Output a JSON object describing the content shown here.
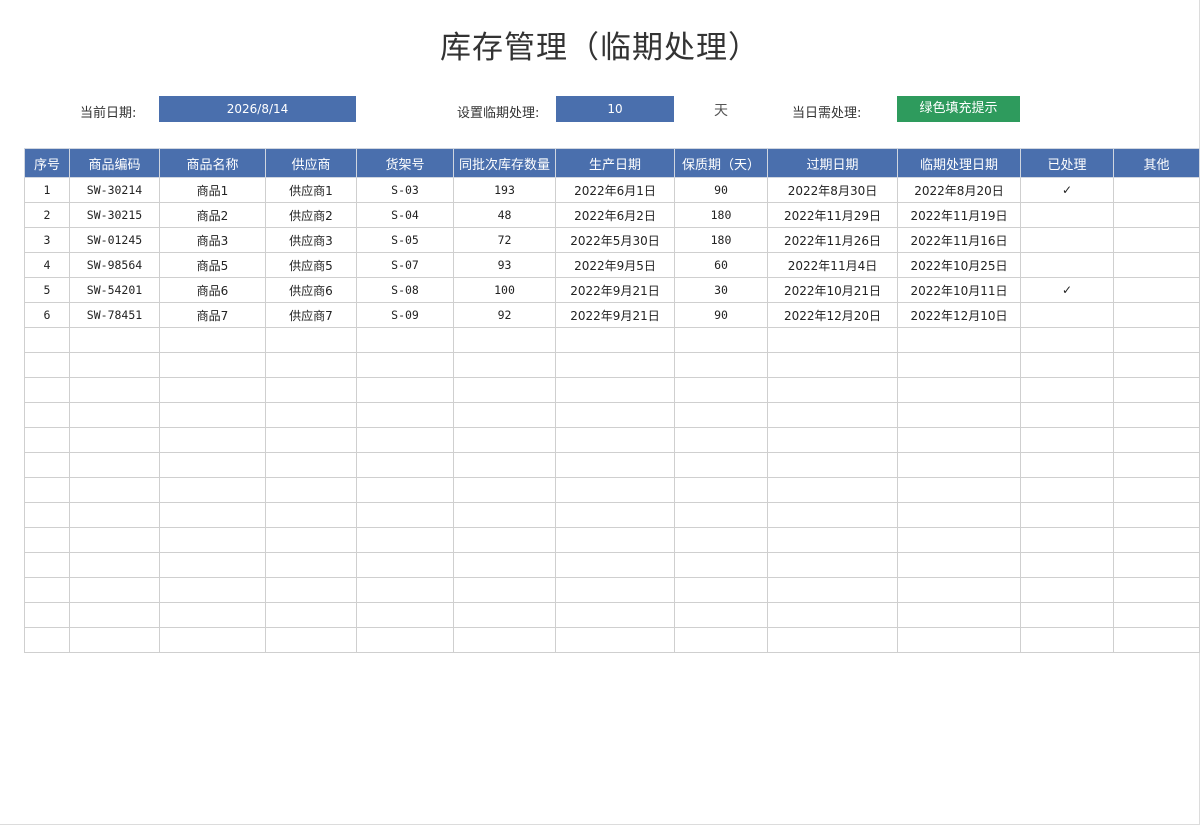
{
  "title": "库存管理（临期处理）",
  "controls": {
    "current_date_label": "当前日期:",
    "current_date_value": "2026/8/14",
    "threshold_label": "设置临期处理:",
    "threshold_value": "10",
    "threshold_unit": "天",
    "today_label": "当日需处理:",
    "today_hint": "绿色填充提示",
    "colors": {
      "input_bg": "#4a6fad",
      "hint_bg": "#2e9b5d",
      "header_bg": "#4a6fad"
    }
  },
  "table": {
    "headers": [
      "序号",
      "商品编码",
      "商品名称",
      "供应商",
      "货架号",
      "同批次库存数量",
      "生产日期",
      "保质期（天）",
      "过期日期",
      "临期处理日期",
      "已处理",
      "其他"
    ],
    "rows": [
      [
        "1",
        "SW-30214",
        "商品1",
        "供应商1",
        "S-03",
        "193",
        "2022年6月1日",
        "90",
        "2022年8月30日",
        "2022年8月20日",
        "✓",
        ""
      ],
      [
        "2",
        "SW-30215",
        "商品2",
        "供应商2",
        "S-04",
        "48",
        "2022年6月2日",
        "180",
        "2022年11月29日",
        "2022年11月19日",
        "",
        ""
      ],
      [
        "3",
        "SW-01245",
        "商品3",
        "供应商3",
        "S-05",
        "72",
        "2022年5月30日",
        "180",
        "2022年11月26日",
        "2022年11月16日",
        "",
        ""
      ],
      [
        "4",
        "SW-98564",
        "商品5",
        "供应商5",
        "S-07",
        "93",
        "2022年9月5日",
        "60",
        "2022年11月4日",
        "2022年10月25日",
        "",
        ""
      ],
      [
        "5",
        "SW-54201",
        "商品6",
        "供应商6",
        "S-08",
        "100",
        "2022年9月21日",
        "30",
        "2022年10月21日",
        "2022年10月11日",
        "✓",
        ""
      ],
      [
        "6",
        "SW-78451",
        "商品7",
        "供应商7",
        "S-09",
        "92",
        "2022年9月21日",
        "90",
        "2022年12月20日",
        "2022年12月10日",
        "",
        ""
      ]
    ],
    "empty_rows": 13
  }
}
